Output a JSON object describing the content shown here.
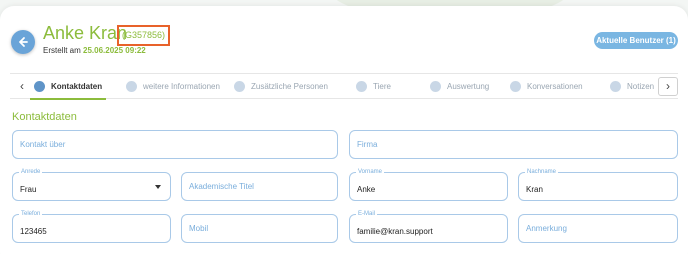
{
  "header": {
    "name": "Anke Kran",
    "customer_id": "(G357856)",
    "created_label": "Erstellt am",
    "created_date": "25.06.2025 09:22",
    "current_users_button": "Aktuelle Benutzer (1)"
  },
  "tabs": [
    {
      "label": "Kontaktdaten",
      "icon": "phone-icon",
      "active": true
    },
    {
      "label": "weitere Informationen",
      "icon": "gear-icon",
      "active": false
    },
    {
      "label": "Zusätzliche Personen",
      "icon": "smiley-icon",
      "active": false
    },
    {
      "label": "Tiere",
      "icon": "paw-icon",
      "active": false
    },
    {
      "label": "Auswertung",
      "icon": "chart-icon",
      "active": false
    },
    {
      "label": "Konversationen",
      "icon": "chat-icon",
      "active": false
    },
    {
      "label": "Notizen",
      "icon": "note-icon",
      "active": false
    }
  ],
  "section_title": "Kontaktdaten",
  "form": {
    "kontakt_ueber": {
      "placeholder": "Kontakt über"
    },
    "firma": {
      "placeholder": "Firma"
    },
    "anrede": {
      "label": "Anrede",
      "value": "Frau"
    },
    "akademische_titel": {
      "placeholder": "Akademische Titel"
    },
    "vorname": {
      "label": "Vorname",
      "value": "Anke"
    },
    "nachname": {
      "label": "Nachname",
      "value": "Kran"
    },
    "telefon": {
      "label": "Telefon",
      "value": "123465"
    },
    "mobil": {
      "placeholder": "Mobil"
    },
    "email": {
      "label": "E-Mail",
      "value": "familie@kran.support"
    },
    "anmerkung": {
      "placeholder": "Anmerkung"
    }
  },
  "colors": {
    "accent_green": "#8cbc3c",
    "accent_blue": "#6aa4d8",
    "highlight": "#e8622a"
  }
}
